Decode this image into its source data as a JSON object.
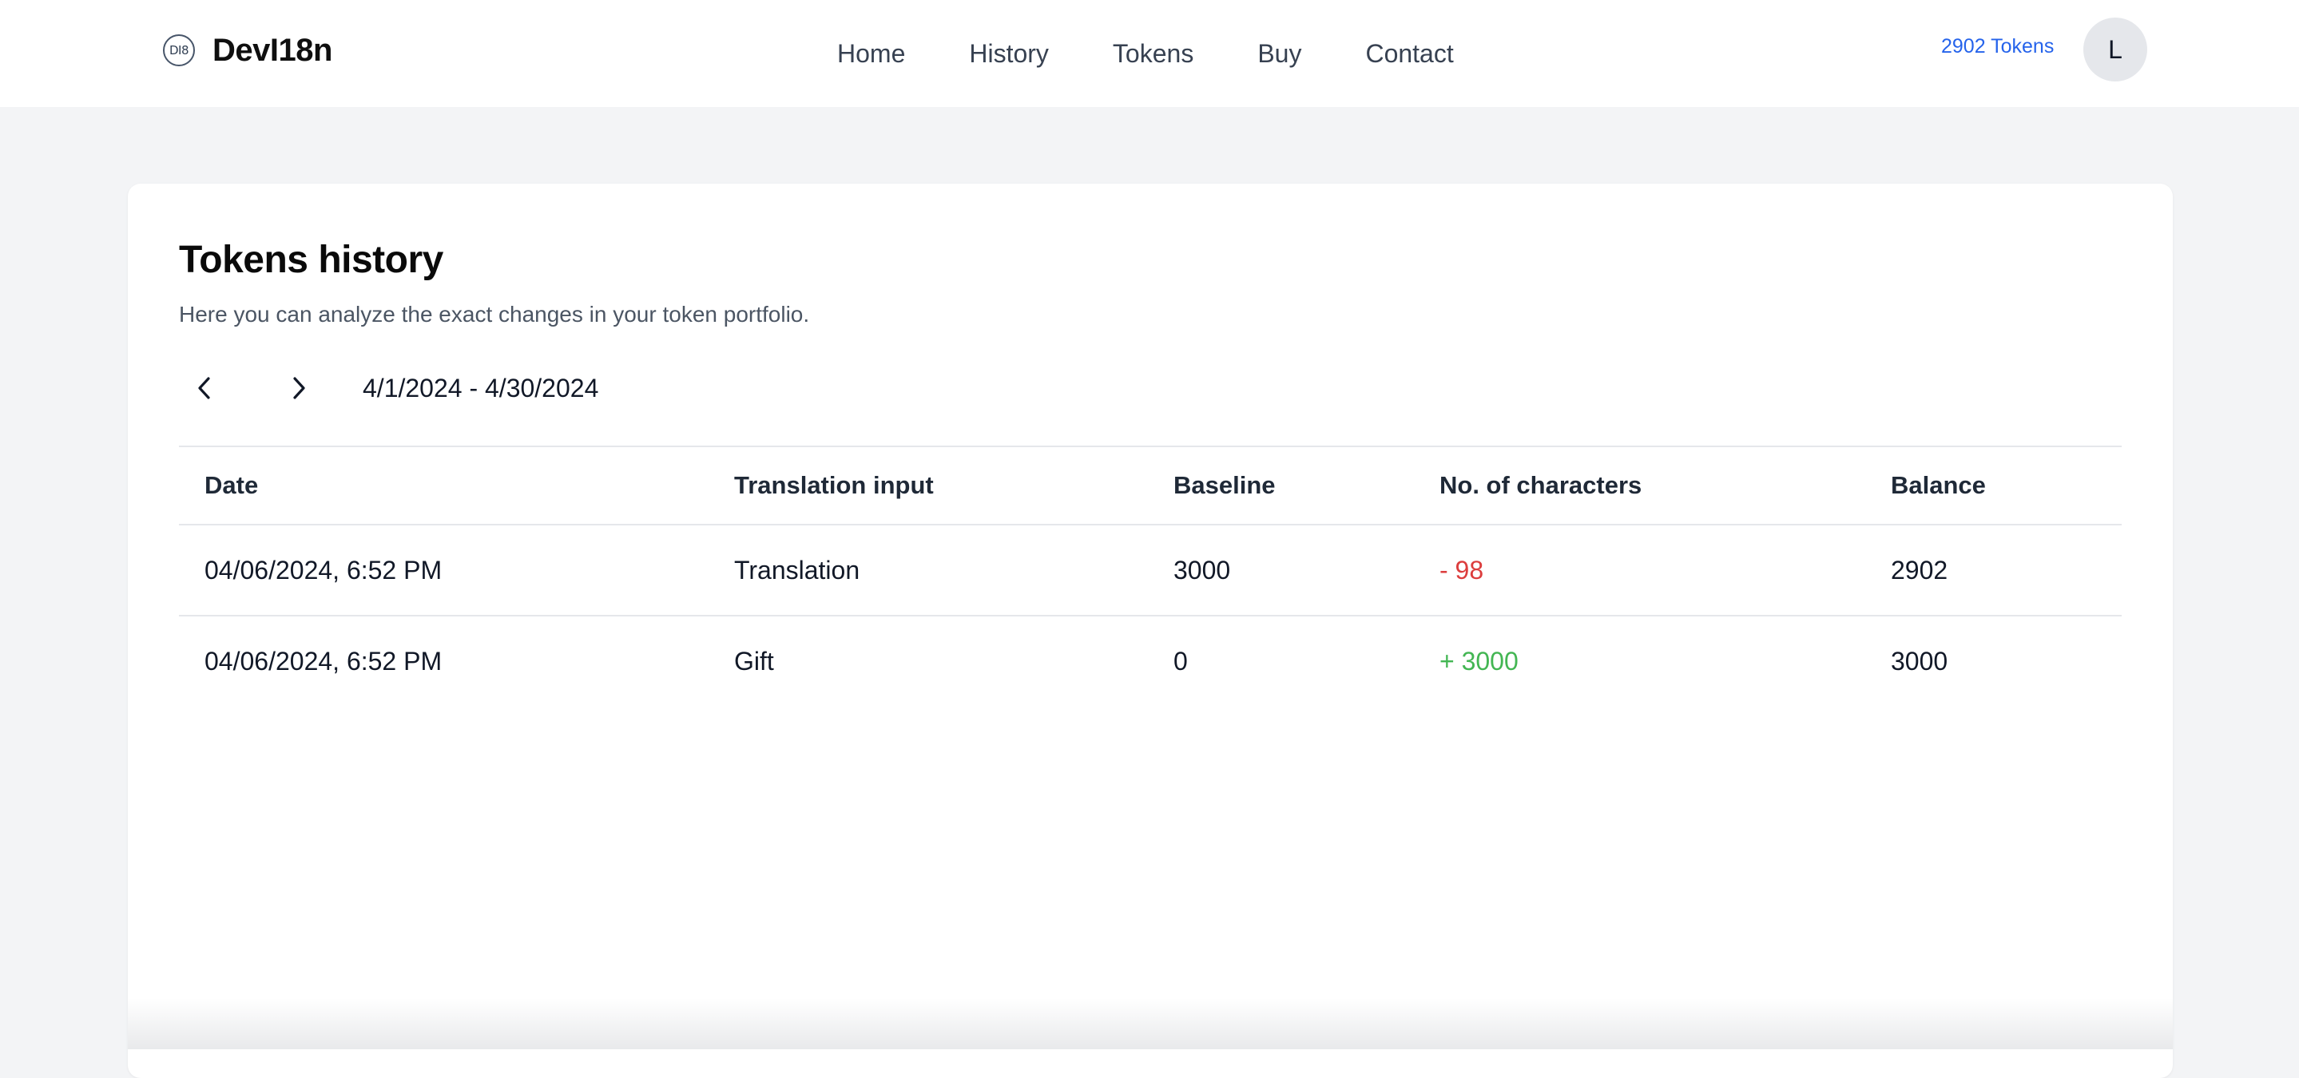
{
  "header": {
    "logo_text": "DI8",
    "brand": "DevI18n",
    "nav": [
      "Home",
      "History",
      "Tokens",
      "Buy",
      "Contact"
    ],
    "token_count": "2902 Tokens",
    "avatar_initial": "L"
  },
  "page": {
    "title": "Tokens history",
    "subtitle": "Here you can analyze the exact changes in your token portfolio.",
    "range": "4/1/2024 - 4/30/2024",
    "prev_icon": "chevron-left-icon",
    "next_icon": "chevron-right-icon"
  },
  "table": {
    "columns": [
      "Date",
      "Translation input",
      "Baseline",
      "No. of characters",
      "Balance"
    ],
    "rows": [
      {
        "date": "04/06/2024, 6:52 PM",
        "input": "Translation",
        "baseline": "3000",
        "chars": "- 98",
        "balance": "2902",
        "sign": "negative"
      },
      {
        "date": "04/06/2024, 6:52 PM",
        "input": "Gift",
        "baseline": "0",
        "chars": "+ 3000",
        "balance": "3000",
        "sign": "positive"
      }
    ]
  },
  "colors": {
    "accent": "#2563eb",
    "negative": "#dc3d3d",
    "positive": "#43b653",
    "background": "#f3f4f6"
  }
}
